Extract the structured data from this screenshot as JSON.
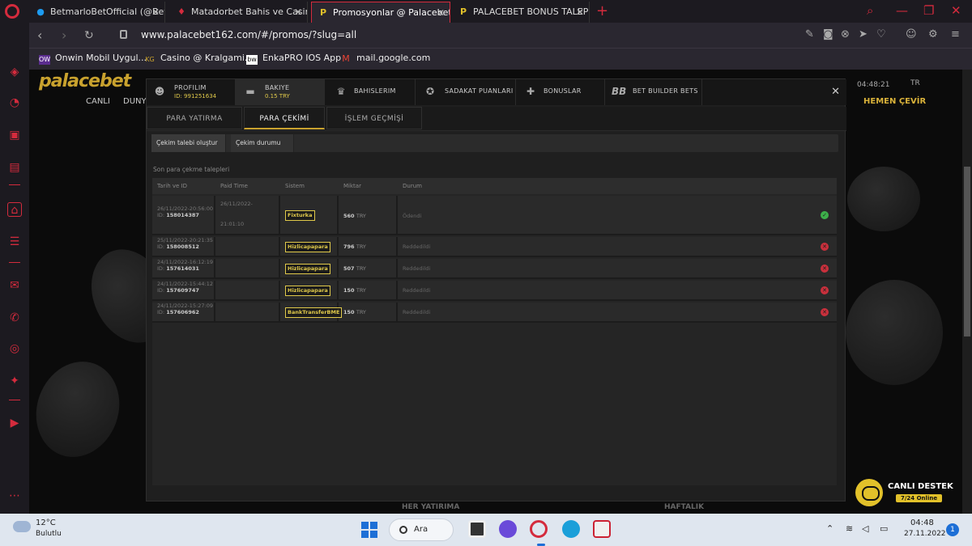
{
  "browser": {
    "tabs": [
      {
        "title": "BetmarloBetOfficial (@Betr",
        "icon": "twitter-icon"
      },
      {
        "title": "Matadorbet Bahis ve Casin",
        "icon": "matadorbet-icon"
      },
      {
        "title": "Promosyonlar @ Palacebet",
        "icon": "palacebet-icon"
      },
      {
        "title": "PALACEBET BONUS TALEP",
        "icon": "palacebet-icon"
      }
    ],
    "url": "www.palacebet162.com/#/promos/?slug=all",
    "bookmarks": [
      {
        "label": "Onwin Mobil Uygul...",
        "badge": "OW"
      },
      {
        "label": "Casino @ Kralgami...",
        "badge": "KG"
      },
      {
        "label": "EnkaPRO IOS App",
        "badge": "bw"
      },
      {
        "label": "mail.google.com",
        "badge": "M"
      }
    ]
  },
  "site": {
    "logo": "palacebet",
    "nav": [
      "CANLI",
      "DUNY"
    ],
    "time": "04:48:21",
    "lang": "TR",
    "promo": "HEMEN ÇEVİR",
    "bottom_left": "HER YATIRIMA",
    "bottom_right": "HAFTALIK"
  },
  "modal": {
    "tabs": [
      {
        "label": "PROFILIM",
        "sub": "ID: 991251634",
        "icon": "user-icon"
      },
      {
        "label": "BAKIYE",
        "sub": "0.15 TRY",
        "icon": "wallet-icon"
      },
      {
        "label": "BAHISLERIM",
        "icon": "trophy-icon"
      },
      {
        "label": "SADAKAT PUANLARI",
        "icon": "star-icon"
      },
      {
        "label": "BONUSLAR",
        "icon": "gift-icon"
      },
      {
        "label": "BET BUILDER BETS",
        "icon": "bb-icon"
      }
    ],
    "subtabs": [
      "PARA YATIRMA",
      "PARA ÇEKİMİ",
      "İŞLEM GEÇMİŞİ"
    ],
    "actions": [
      "Çekim talebi oluştur",
      "Çekim durumu"
    ],
    "section_title": "Son para çekme talepleri",
    "columns": [
      "Tarih ve ID",
      "Paid Time",
      "Sistem",
      "Miktar",
      "Durum"
    ],
    "rows": [
      {
        "date": "26/11/2022-20:56:00",
        "id": "158014387",
        "paid_date": "26/11/2022-",
        "paid_time": "21:01:10",
        "system": "Fixturka",
        "amount": "560",
        "currency": "TRY",
        "status": "Ödendi",
        "ok": true
      },
      {
        "date": "25/11/2022-20:21:35",
        "id": "158008512",
        "paid_date": "",
        "paid_time": "",
        "system": "Hizlicapapara",
        "amount": "796",
        "currency": "TRY",
        "status": "Reddedildi",
        "ok": false
      },
      {
        "date": "24/11/2022-16:12:19",
        "id": "157614031",
        "paid_date": "",
        "paid_time": "",
        "system": "Hizlicapapara",
        "amount": "507",
        "currency": "TRY",
        "status": "Reddedildi",
        "ok": false
      },
      {
        "date": "24/11/2022-15:44:12",
        "id": "157609747",
        "paid_date": "",
        "paid_time": "",
        "system": "Hizlicapapara",
        "amount": "150",
        "currency": "TRY",
        "status": "Reddedildi",
        "ok": false
      },
      {
        "date": "24/11/2022-15:27:09",
        "id": "157606962",
        "paid_date": "",
        "paid_time": "",
        "system": "BankTransferBME",
        "amount": "150",
        "currency": "TRY",
        "status": "Reddedildi",
        "ok": false
      }
    ]
  },
  "support": {
    "label": "CANLI DESTEK",
    "sub": "7/24 Online"
  },
  "taskbar": {
    "temp": "12°C",
    "weather": "Bulutlu",
    "search": "Ara",
    "time": "04:48",
    "date": "27.11.2022",
    "notifications": "1"
  }
}
